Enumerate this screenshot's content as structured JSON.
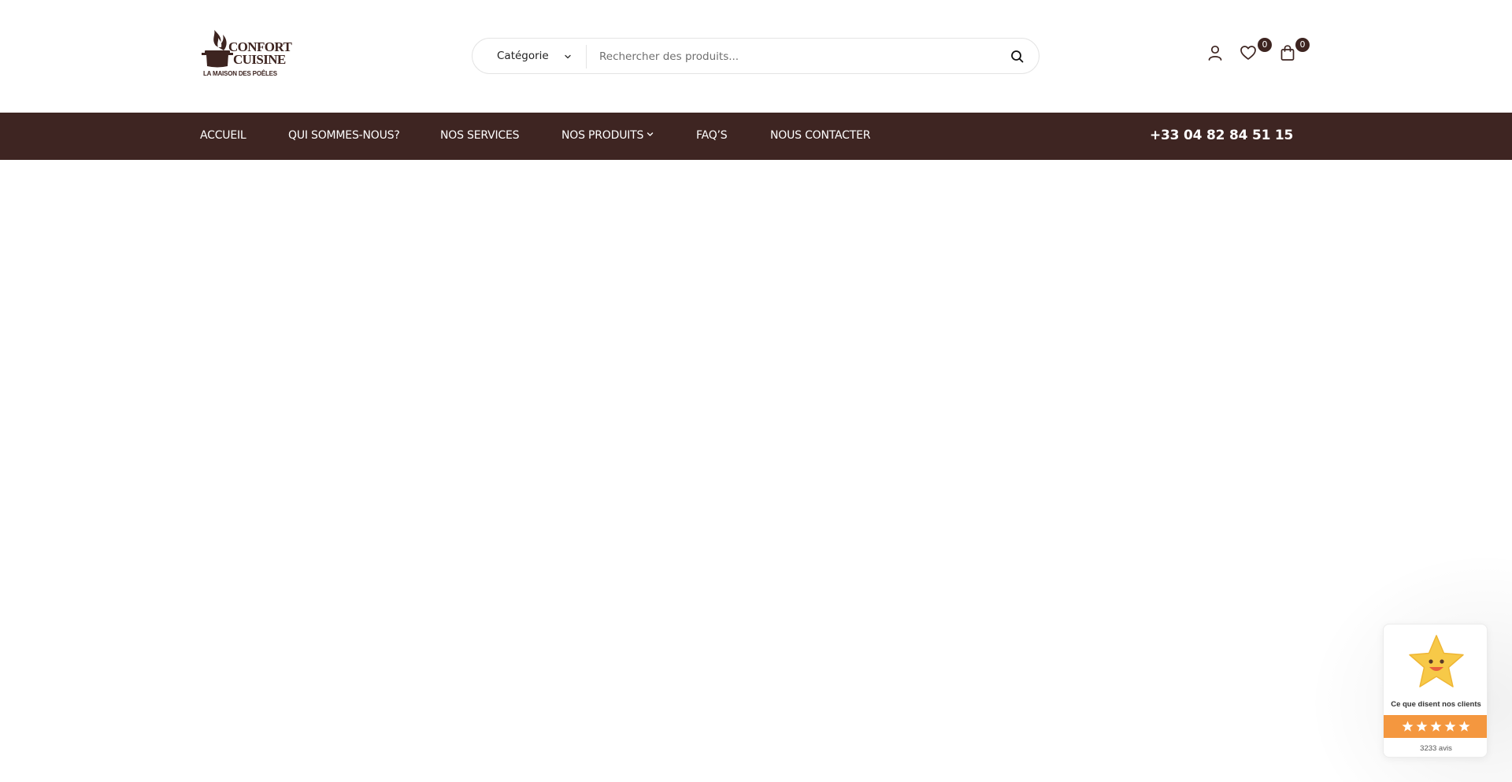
{
  "brand": {
    "name_line1": "CONFORT",
    "name_line2": "CUISINE",
    "tagline": "LA MAISON DES POÊLES"
  },
  "search": {
    "category_label": "Catégorie",
    "placeholder": "Rechercher des produits..."
  },
  "header_icons": {
    "user": "user-icon",
    "wishlist": "heart-icon",
    "cart": "shopping-bag-icon",
    "wishlist_count": "0",
    "cart_count": "0"
  },
  "nav": {
    "items": [
      {
        "label": "ACCUEIL"
      },
      {
        "label": "QUI SOMMES-NOUS?"
      },
      {
        "label": "NOS SERVICES"
      },
      {
        "label": "NOS PRODUITS"
      },
      {
        "label": "FAQ’S"
      },
      {
        "label": "NOUS CONTACTER"
      }
    ],
    "phone": "+33 04 82 84 51 15"
  },
  "reviews_widget": {
    "title": "Ce que disent nos clients",
    "rating_stars": 5,
    "count_label": "3233 avis"
  },
  "colors": {
    "brand_brown": "#3e2522",
    "review_orange": "#f4973f",
    "star_yellow": "#f7c948"
  }
}
